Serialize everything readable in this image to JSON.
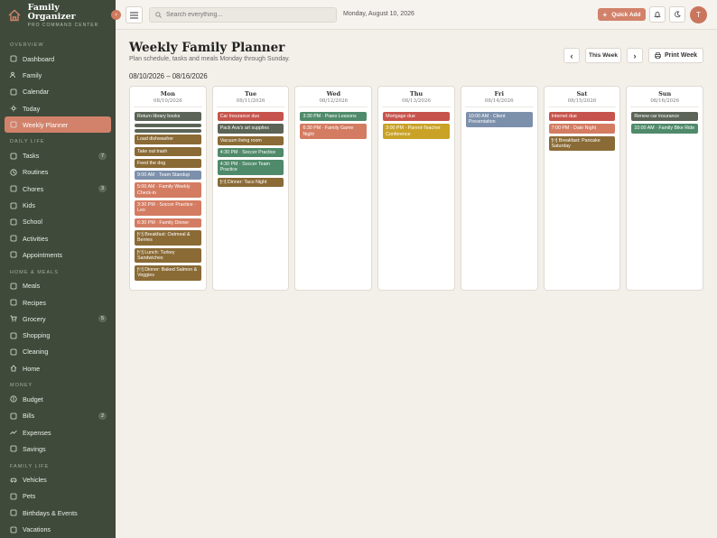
{
  "app": {
    "title": "Family Organizer",
    "subtitle": "PRO COMMAND CENTER"
  },
  "sidebar": {
    "sections": [
      {
        "label": "OVERVIEW",
        "items": [
          {
            "label": "Dashboard",
            "icon": "dashboard-icon"
          },
          {
            "label": "Family",
            "icon": "users-icon"
          },
          {
            "label": "Calendar",
            "icon": "calendar-icon"
          },
          {
            "label": "Today",
            "icon": "sun-icon"
          },
          {
            "label": "Weekly Planner",
            "icon": "planner-icon",
            "active": true
          }
        ]
      },
      {
        "label": "DAILY LIFE",
        "items": [
          {
            "label": "Tasks",
            "icon": "checkbox-icon",
            "badge": "7"
          },
          {
            "label": "Routines",
            "icon": "clock-icon"
          },
          {
            "label": "Chores",
            "icon": "broom-icon",
            "badge": "3"
          },
          {
            "label": "Kids",
            "icon": "star-icon"
          },
          {
            "label": "School",
            "icon": "school-icon"
          },
          {
            "label": "Activities",
            "icon": "activity-icon"
          },
          {
            "label": "Appointments",
            "icon": "appointment-icon"
          }
        ]
      },
      {
        "label": "HOME & MEALS",
        "items": [
          {
            "label": "Meals",
            "icon": "meals-icon"
          },
          {
            "label": "Recipes",
            "icon": "book-icon"
          },
          {
            "label": "Grocery",
            "icon": "cart-icon",
            "badge": "5"
          },
          {
            "label": "Shopping",
            "icon": "bag-icon"
          },
          {
            "label": "Cleaning",
            "icon": "sparkle-icon"
          },
          {
            "label": "Home",
            "icon": "home-icon"
          }
        ]
      },
      {
        "label": "MONEY",
        "items": [
          {
            "label": "Budget",
            "icon": "dollar-icon"
          },
          {
            "label": "Bills",
            "icon": "receipt-icon",
            "badge": "2"
          },
          {
            "label": "Expenses",
            "icon": "trend-icon"
          },
          {
            "label": "Savings",
            "icon": "piggy-icon"
          }
        ]
      },
      {
        "label": "FAMILY LIFE",
        "items": [
          {
            "label": "Vehicles",
            "icon": "car-icon"
          },
          {
            "label": "Pets",
            "icon": "paw-icon"
          },
          {
            "label": "Birthdays & Events",
            "icon": "gift-icon"
          },
          {
            "label": "Vacations",
            "icon": "plane-icon"
          }
        ]
      }
    ]
  },
  "topbar": {
    "search_placeholder": "Search everything...",
    "date": "Monday, August 10, 2026",
    "quick_add": "Quick Add",
    "avatar_initial": "T"
  },
  "page": {
    "title": "Weekly Family Planner",
    "subtitle": "Plan schedule, tasks and meals Monday through Sunday.",
    "range": "08/10/2026 – 08/16/2026",
    "this_week": "This Week",
    "print_week": "Print Week"
  },
  "colors": {
    "dark": "#5b6456",
    "brown": "#8a6a35",
    "green": "#4f8a6a",
    "red": "#c6544c",
    "salmon": "#d47c62",
    "blue": "#7d90ab",
    "gold": "#c9a227"
  },
  "days": [
    {
      "name": "Mon",
      "date": "08/10/2026",
      "events": [
        {
          "text": "Return library books",
          "color": "dark"
        },
        {
          "text": "",
          "color": "dark"
        },
        {
          "text": "",
          "color": "dark"
        },
        {
          "text": "Load dishwasher",
          "color": "brown"
        },
        {
          "text": "Take out trash",
          "color": "brown"
        },
        {
          "text": "Feed the dog",
          "color": "brown"
        },
        {
          "text": "9:00 AM · Team Standup",
          "color": "blue"
        },
        {
          "text": "5:00 AM · Family Weekly Check-in",
          "color": "salmon"
        },
        {
          "text": "3:30 PM · Soccer Practice · Leo",
          "color": "salmon"
        },
        {
          "text": "6:30 PM · Family Dinner",
          "color": "salmon"
        },
        {
          "text": "🍽 Breakfast: Oatmeal & Berries",
          "color": "brown"
        },
        {
          "text": "🍽 Lunch: Turkey Sandwiches",
          "color": "brown"
        },
        {
          "text": "🍽 Dinner: Baked Salmon & Veggies",
          "color": "brown"
        }
      ]
    },
    {
      "name": "Tue",
      "date": "08/11/2026",
      "events": [
        {
          "text": "Car Insurance due",
          "color": "red"
        },
        {
          "text": "Pack Ava's art supplies",
          "color": "dark"
        },
        {
          "text": "Vacuum living room",
          "color": "brown"
        },
        {
          "text": "4:30 PM · Soccer Practice",
          "color": "green"
        },
        {
          "text": "4:30 PM · Soccer Team Practice",
          "color": "green"
        },
        {
          "text": "🍽 Dinner: Taco Night",
          "color": "brown"
        }
      ]
    },
    {
      "name": "Wed",
      "date": "08/12/2026",
      "events": [
        {
          "text": "3:30 PM · Piano Lessons",
          "color": "green"
        },
        {
          "text": "6:30 PM · Family Game Night",
          "color": "salmon"
        }
      ]
    },
    {
      "name": "Thu",
      "date": "08/13/2026",
      "events": [
        {
          "text": "Mortgage due",
          "color": "red"
        },
        {
          "text": "3:00 PM · Parent-Teacher Conference",
          "color": "gold"
        }
      ]
    },
    {
      "name": "Fri",
      "date": "08/14/2026",
      "events": [
        {
          "text": "10:00 AM · Client Presentation",
          "color": "blue"
        }
      ]
    },
    {
      "name": "Sat",
      "date": "08/15/2026",
      "events": [
        {
          "text": "Internet due",
          "color": "red"
        },
        {
          "text": "7:00 PM · Date Night",
          "color": "salmon"
        },
        {
          "text": "🍽 Breakfast: Pancake Saturday",
          "color": "brown"
        }
      ]
    },
    {
      "name": "Sun",
      "date": "08/16/2026",
      "events": [
        {
          "text": "Renew car insurance",
          "color": "dark"
        },
        {
          "text": "10:00 AM · Family Bike Ride",
          "color": "green"
        }
      ]
    }
  ]
}
